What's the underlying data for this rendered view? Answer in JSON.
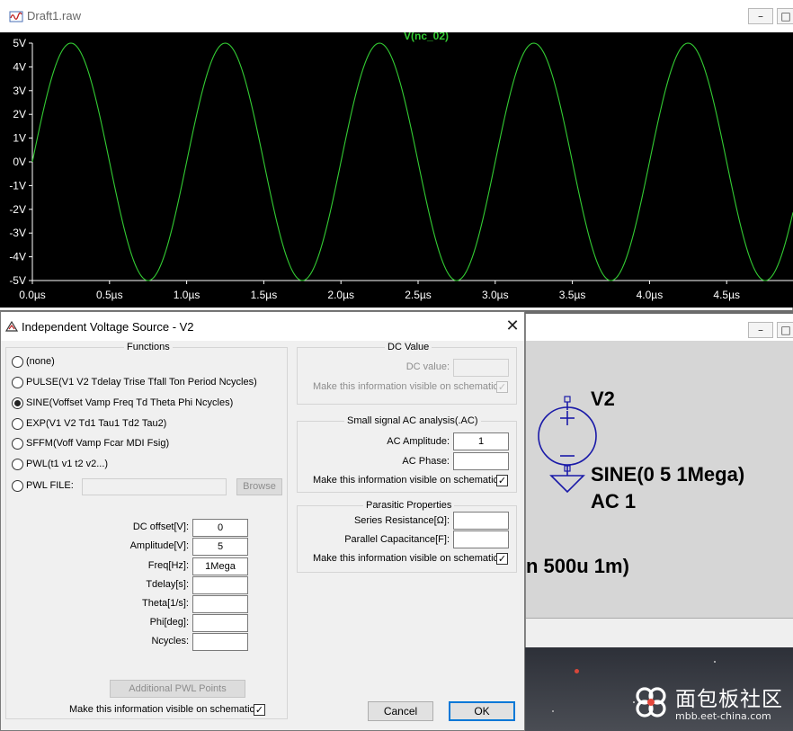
{
  "waveform_window": {
    "title": "Draft1.raw",
    "minimize_glyph": "–",
    "maximize_glyph": "□",
    "trace_label": "V(nc_02)",
    "trace_color": "#33cc33"
  },
  "chart_data": {
    "type": "line",
    "title": "V(nc_02)",
    "xlabel": "",
    "ylabel": "",
    "x_ticks": [
      "0.0µs",
      "0.5µs",
      "1.0µs",
      "1.5µs",
      "2.0µs",
      "2.5µs",
      "3.0µs",
      "3.5µs",
      "4.0µs",
      "4.5µs"
    ],
    "y_ticks": [
      "5V",
      "4V",
      "3V",
      "2V",
      "1V",
      "0V",
      "-1V",
      "-2V",
      "-3V",
      "-4V",
      "-5V"
    ],
    "xlim": [
      0,
      4.93
    ],
    "ylim": [
      -5,
      5
    ],
    "x_unit": "µs",
    "grid": false,
    "series": [
      {
        "offset_v": 0,
        "amplitude_v": 5,
        "frequency_mhz": 1,
        "color": "#33cc33"
      }
    ]
  },
  "dialog": {
    "title": "Independent Voltage Source - V2",
    "close_glyph": "✕",
    "functions": {
      "label": "Functions",
      "options": [
        {
          "label": "(none)",
          "selected": false
        },
        {
          "label": "PULSE(V1 V2 Tdelay Trise Tfall Ton Period Ncycles)",
          "selected": false
        },
        {
          "label": "SINE(Voffset Vamp Freq Td Theta Phi Ncycles)",
          "selected": true
        },
        {
          "label": "EXP(V1 V2 Td1 Tau1 Td2 Tau2)",
          "selected": false
        },
        {
          "label": "SFFM(Voff Vamp Fcar MDI Fsig)",
          "selected": false
        },
        {
          "label": "PWL(t1 v1 t2 v2...)",
          "selected": false
        },
        {
          "label": "PWL FILE:",
          "selected": false
        }
      ],
      "browse_label": "Browse",
      "params": [
        {
          "label": "DC offset[V]:",
          "value": "0"
        },
        {
          "label": "Amplitude[V]:",
          "value": "5"
        },
        {
          "label": "Freq[Hz]:",
          "value": "1Mega"
        },
        {
          "label": "Tdelay[s]:",
          "value": ""
        },
        {
          "label": "Theta[1/s]:",
          "value": ""
        },
        {
          "label": "Phi[deg]:",
          "value": ""
        },
        {
          "label": "Ncycles:",
          "value": ""
        }
      ],
      "additional_pwl_label": "Additional PWL Points",
      "visible_label": "Make this information visible on schematic:",
      "visible_checked": true
    },
    "dc_value": {
      "label": "DC Value",
      "field_label": "DC value:",
      "value": "",
      "visible_label": "Make this information visible on schematic:",
      "visible_checked": true
    },
    "ac": {
      "label": "Small signal AC analysis(.AC)",
      "amplitude_label": "AC Amplitude:",
      "amplitude_value": "1",
      "phase_label": "AC Phase:",
      "phase_value": "",
      "visible_label": "Make this information visible on schematic:",
      "visible_checked": true
    },
    "parasitic": {
      "label": "Parasitic Properties",
      "series_label": "Series Resistance[Ω]:",
      "series_value": "",
      "parallel_label": "Parallel Capacitance[F]:",
      "parallel_value": "",
      "visible_label": "Make this information visible on schematic:",
      "visible_checked": true
    },
    "cancel_label": "Cancel",
    "ok_label": "OK"
  },
  "schematic": {
    "minimize_glyph": "–",
    "maximize_glyph": "□",
    "component_name": "V2",
    "function_text": "SINE(0 5 1Mega)",
    "ac_text": "AC 1",
    "partial_text": "n 500u 1m)"
  },
  "watermark": {
    "text": "面包板社区",
    "url": "mbb.eet-china.com"
  },
  "check_glyph": "✓",
  "colors": {
    "plot_bg": "#000000",
    "axis_text": "#ffffff",
    "dialog_bg": "#f0f0f0",
    "ok_border": "#0078d7"
  }
}
